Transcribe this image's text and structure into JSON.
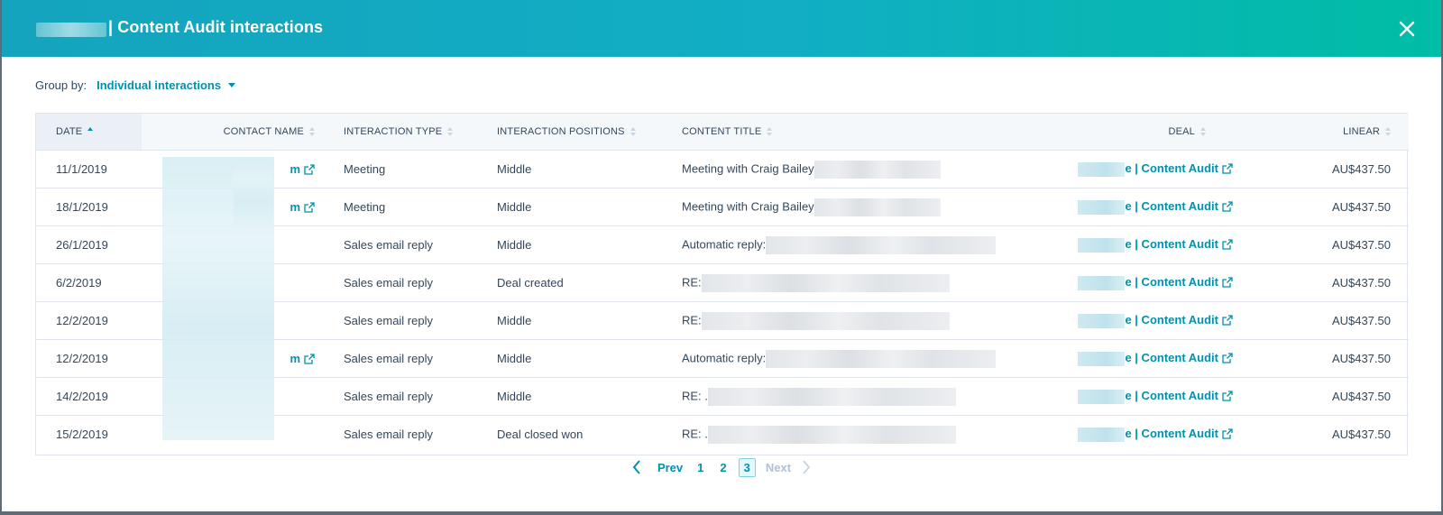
{
  "header": {
    "title": "| Content Audit interactions",
    "close_icon": "close-icon"
  },
  "group_by": {
    "label": "Group by:",
    "value": "Individual interactions"
  },
  "table": {
    "columns": [
      "DATE",
      "CONTACT NAME",
      "INTERACTION TYPE",
      "INTERACTION POSITIONS",
      "CONTENT TITLE",
      "DEAL",
      "LINEAR"
    ],
    "rows": [
      {
        "date": "11/1/2019",
        "contact_suffix": "m",
        "type": "Meeting",
        "position": "Middle",
        "content": "Meeting with Craig Bailey",
        "deal": "e | Content Audit",
        "linear": "AU$437.50"
      },
      {
        "date": "18/1/2019",
        "contact_suffix": "m",
        "type": "Meeting",
        "position": "Middle",
        "content": "Meeting with Craig Bailey",
        "deal": "e | Content Audit",
        "linear": "AU$437.50"
      },
      {
        "date": "26/1/2019",
        "contact_suffix": "",
        "type": "Sales email reply",
        "position": "Middle",
        "content": "Automatic reply:",
        "deal": "e | Content Audit",
        "linear": "AU$437.50"
      },
      {
        "date": "6/2/2019",
        "contact_suffix": "",
        "type": "Sales email reply",
        "position": "Deal created",
        "content": "RE:",
        "deal": "e | Content Audit",
        "linear": "AU$437.50"
      },
      {
        "date": "12/2/2019",
        "contact_suffix": "",
        "type": "Sales email reply",
        "position": "Middle",
        "content": "RE:",
        "deal": "e | Content Audit",
        "linear": "AU$437.50"
      },
      {
        "date": "12/2/2019",
        "contact_suffix": "m",
        "type": "Sales email reply",
        "position": "Middle",
        "content": "Automatic reply:",
        "deal": "e | Content Audit",
        "linear": "AU$437.50"
      },
      {
        "date": "14/2/2019",
        "contact_suffix": "",
        "type": "Sales email reply",
        "position": "Middle",
        "content": "RE: .",
        "deal": "e | Content Audit",
        "linear": "AU$437.50"
      },
      {
        "date": "15/2/2019",
        "contact_suffix": "",
        "type": "Sales email reply",
        "position": "Deal closed won",
        "content": "RE: .",
        "deal": "e | Content Audit",
        "linear": "AU$437.50"
      }
    ]
  },
  "pagination": {
    "prev": "Prev",
    "next": "Next",
    "pages": [
      "1",
      "2",
      "3"
    ],
    "current": "3"
  },
  "colors": {
    "header_gradient_start": "#14a4be",
    "header_gradient_end": "#00bda5",
    "link": "#0091ae",
    "text": "#33475b"
  }
}
